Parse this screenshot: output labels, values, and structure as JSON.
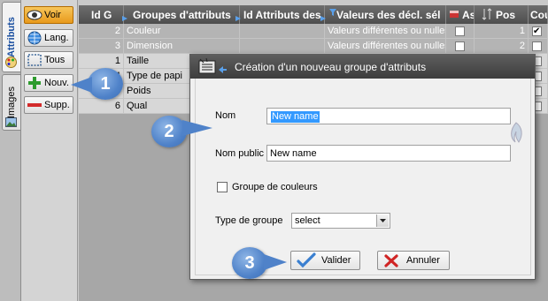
{
  "side_tabs": {
    "attributs": "Attributs",
    "images": "Images"
  },
  "toolbar": {
    "voir": "Voir",
    "lang": "Lang.",
    "tous": "Tous",
    "nouv": "Nouv.",
    "supp": "Supp."
  },
  "grid": {
    "headers": [
      "Id G",
      "Groupes d'attributs",
      "Id Attributs des",
      "Valeurs des décl. sél",
      "As",
      "Pos",
      "Cou"
    ],
    "rows": [
      {
        "id": "2",
        "name": "Couleur",
        "values": "Valeurs différentes ou nulles",
        "pos": "1",
        "checked": true,
        "selected": true
      },
      {
        "id": "3",
        "name": "Dimension",
        "values": "Valeurs différentes ou nulles",
        "pos": "2",
        "checked": false,
        "selected": true
      },
      {
        "id": "1",
        "name": "Taille",
        "values": "",
        "pos": "",
        "checked": false,
        "selected": false
      },
      {
        "id": "4",
        "name": "Type de papi",
        "values": "",
        "pos": "",
        "checked": false,
        "selected": false
      },
      {
        "id": "5",
        "name": "Poids",
        "values": "",
        "pos": "",
        "checked": false,
        "selected": false
      },
      {
        "id": "6",
        "name": "Qual",
        "values": "",
        "pos": "",
        "checked": false,
        "selected": false
      }
    ]
  },
  "dialog": {
    "title": "Création d'un nouveau groupe d'attributs",
    "nom_label": "Nom",
    "nom_value": "New name",
    "nom_public_label": "Nom public",
    "nom_public_value": "New name",
    "groupe_couleurs_label": "Groupe de couleurs",
    "groupe_couleurs_checked": false,
    "type_groupe_label": "Type de groupe",
    "type_groupe_value": "select",
    "valider": "Valider",
    "annuler": "Annuler"
  },
  "callouts": [
    "1",
    "2",
    "3"
  ],
  "colors": {
    "accent_blue": "#4f82c9",
    "voir_orange": "#e89a1c",
    "add_green": "#2e9b2e",
    "delete_red": "#d22a2a"
  }
}
